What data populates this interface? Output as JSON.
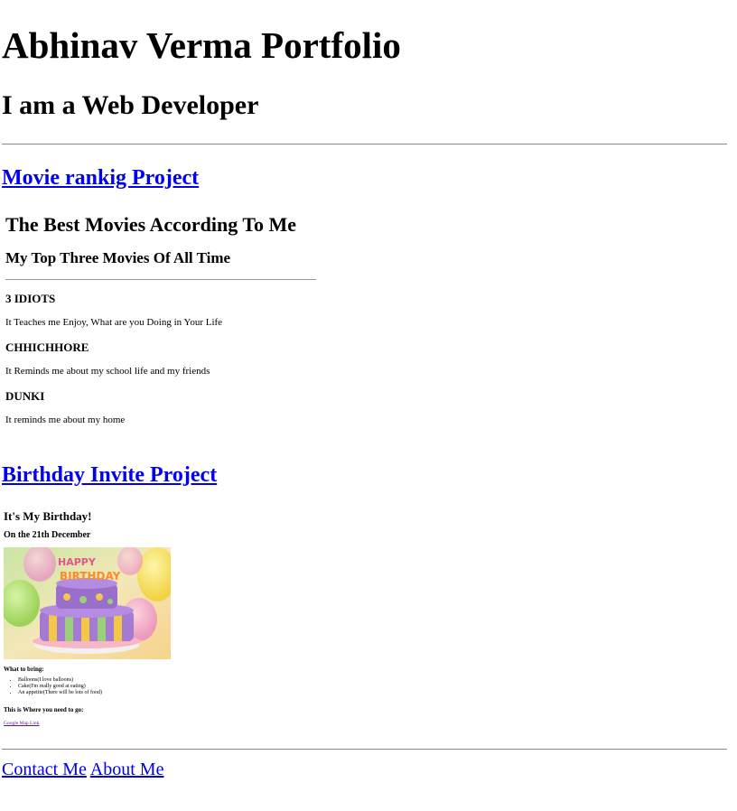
{
  "header": {
    "title": "Abhinav Verma Portfolio",
    "subtitle": "I am a Web Developer"
  },
  "projects": {
    "movie_link": "Movie rankig Project",
    "birthday_link": "Birthday Invite Project"
  },
  "movie_page": {
    "title": "The Best Movies According To Me",
    "subtitle": "My Top Three Movies Of All Time",
    "movies": [
      {
        "title": "3 IDIOTS",
        "desc": "It Teaches me Enjoy, What are you Doing in Your Life"
      },
      {
        "title": "CHHICHHORE",
        "desc": "It Reminds me about my school life and my friends"
      },
      {
        "title": "DUNKI",
        "desc": "It reminds me about my home"
      }
    ]
  },
  "birthday_page": {
    "title": "It's My Birthday!",
    "date": "On the 21th December",
    "what_to_bring": "What to bring:",
    "items": [
      "Balloons(I love balloons)",
      "Cake(I'm really good at eating)",
      "An appetite(There will be lots of food)"
    ],
    "where": "This is Where you need to go:",
    "map_link": "Google Map Link"
  },
  "footer": {
    "contact": "Contact Me",
    "about": "About Me"
  },
  "colors": {
    "link": "#0000ee",
    "visited": "#551a8b"
  }
}
